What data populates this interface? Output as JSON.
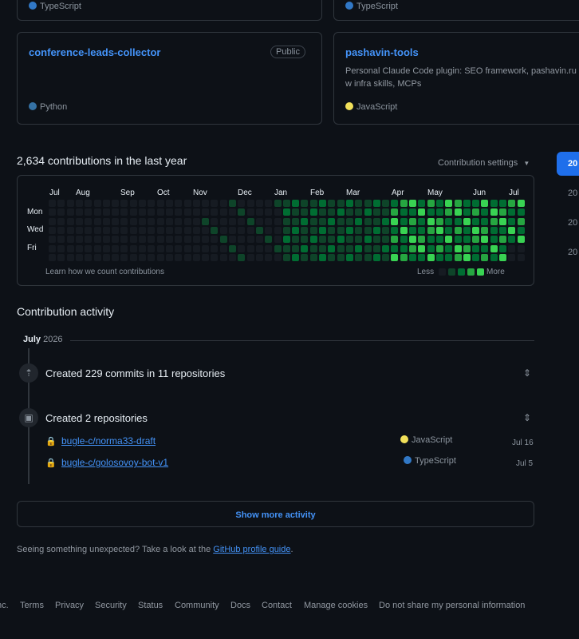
{
  "pinned": {
    "top_left_lang": {
      "name": "TypeScript",
      "color": "#3178c6"
    },
    "top_right_lang": {
      "name": "TypeScript",
      "color": "#3178c6"
    },
    "cards": [
      {
        "name": "conference-leads-collector",
        "badge": "Public",
        "desc": "",
        "lang": "Python",
        "lang_color": "#3572A5"
      },
      {
        "name": "pashavin-tools",
        "badge": "",
        "desc": "Personal Claude Code plugin: SEO framework, pashavin.ru w infra skills, MCPs",
        "lang": "JavaScript",
        "lang_color": "#f1e05a"
      }
    ]
  },
  "contributions": {
    "title": "2,634 contributions in the last year",
    "settings_label": "Contribution settings",
    "months": [
      "Jul",
      "Aug",
      "Sep",
      "Oct",
      "Nov",
      "Dec",
      "Jan",
      "Feb",
      "Mar",
      "Apr",
      "May",
      "Jun",
      "Jul"
    ],
    "days": [
      "Mon",
      "Wed",
      "Fri"
    ],
    "learn_link": "Learn how we count contributions",
    "less": "Less",
    "more": "More",
    "colors": [
      "#161b22",
      "#0e4429",
      "#006d32",
      "#26a641",
      "#39d353"
    ]
  },
  "year_list": [
    "20",
    "20",
    "20",
    "20"
  ],
  "activity": {
    "heading": "Contribution activity",
    "month_label": "July",
    "year_label": "2026",
    "items": [
      {
        "title": "Created 229 commits in 11 repositories"
      },
      {
        "title": "Created 2 repositories",
        "repos": [
          {
            "name": "bugle-c/norma33-draft",
            "lang": "JavaScript",
            "lang_color": "#f1e05a",
            "date": "Jul 16"
          },
          {
            "name": "bugle-c/golosovoy-bot-v1",
            "lang": "TypeScript",
            "lang_color": "#3178c6",
            "date": "Jul 5"
          }
        ]
      }
    ],
    "show_more": "Show more activity",
    "unexpected_text": "Seeing something unexpected? Take a look at the",
    "guide_link": "GitHub profile guide",
    "guide_suffix": "."
  },
  "footer": [
    "nc.",
    "Terms",
    "Privacy",
    "Security",
    "Status",
    "Community",
    "Docs",
    "Contact",
    "Manage cookies",
    "Do not share my personal information"
  ]
}
